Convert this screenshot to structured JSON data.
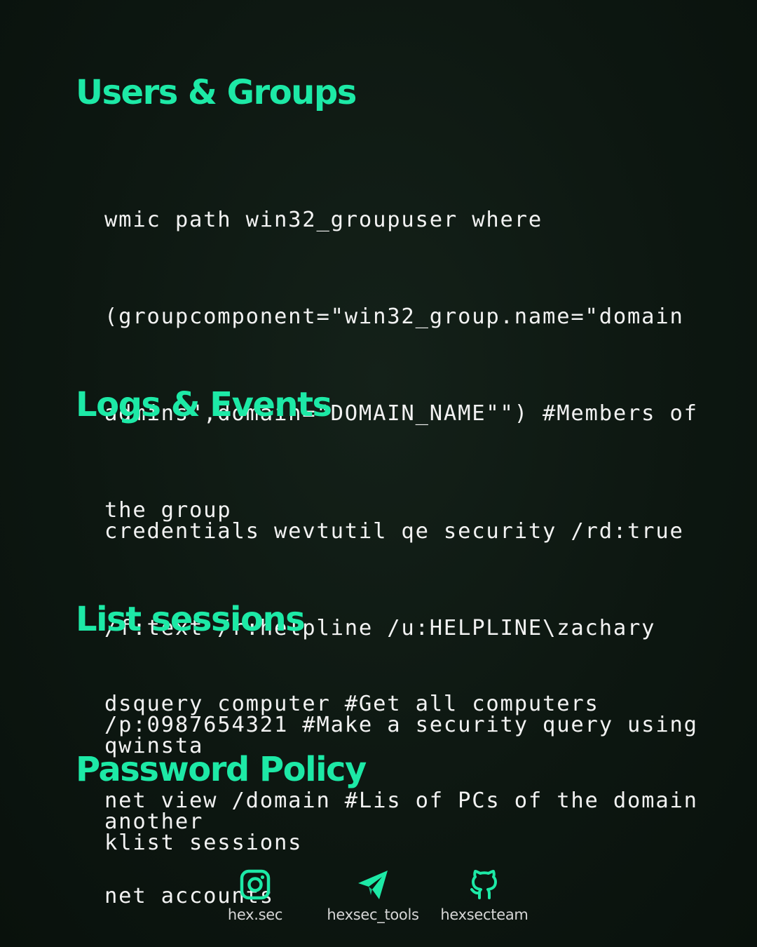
{
  "sections": [
    {
      "title": "Users & Groups",
      "lines": [
        "wmic path win32_groupuser where",
        "(groupcomponent=\"win32_group.name=\"domain",
        "admins\",domain=\"DOMAIN_NAME\"\") #Members of",
        "the group",
        "",
        "dsquery computer #Get all computers",
        "net view /domain #Lis of PCs of the domain"
      ]
    },
    {
      "title": "Logs & Events",
      "lines": [
        "credentials wevtutil qe security /rd:true",
        "/f:text /r:helpline /u:HELPLINE\\zachary",
        "/p:0987654321 #Make a security query using",
        "another"
      ]
    },
    {
      "title": "List sessions",
      "lines": [
        "qwinsta",
        "klist sessions"
      ]
    },
    {
      "title": "Password Policy",
      "lines": [
        "net accounts"
      ]
    }
  ],
  "footer": {
    "links": [
      {
        "icon": "instagram-icon",
        "label": "hex.sec"
      },
      {
        "icon": "telegram-icon",
        "label": "hexsec_tools"
      },
      {
        "icon": "github-icon",
        "label": "hexsecteam"
      }
    ]
  },
  "colors": {
    "accent": "#1de9a6",
    "text": "#f2f2f2",
    "background": "#0d1711"
  }
}
